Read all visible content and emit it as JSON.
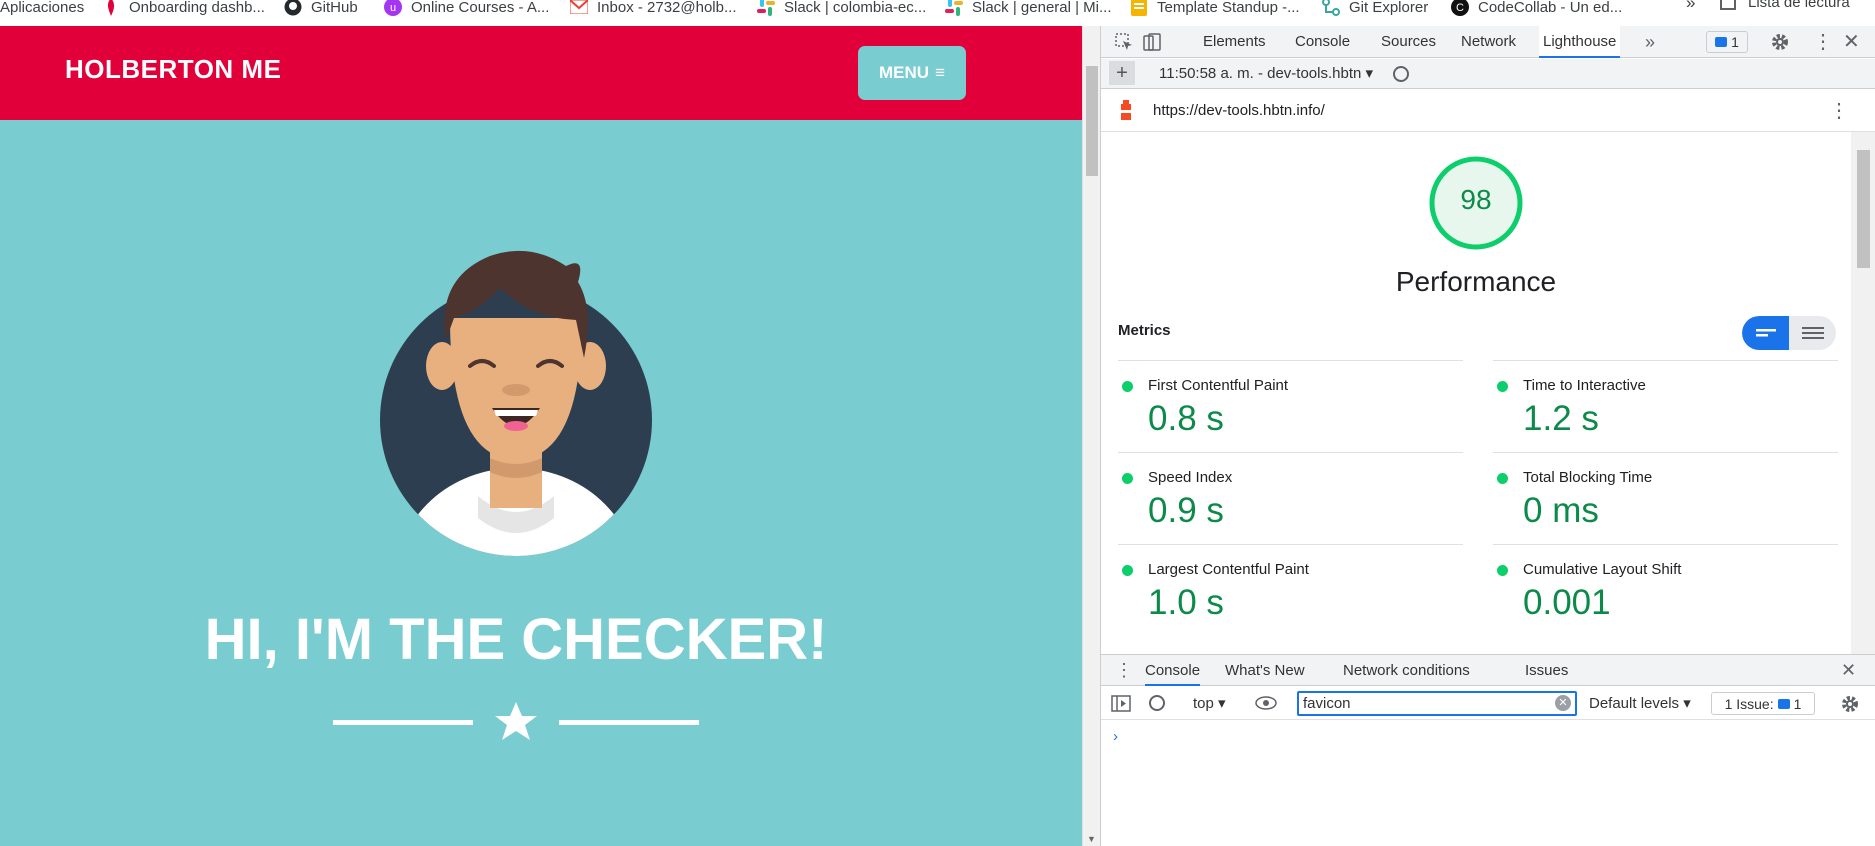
{
  "bookmarks": {
    "items": [
      {
        "label": "Aplicaciones",
        "icon": "apps-grid-icon"
      },
      {
        "label": "Onboarding dashb...",
        "icon": "holberton-icon"
      },
      {
        "label": "GitHub",
        "icon": "github-icon"
      },
      {
        "label": "Online Courses - A...",
        "icon": "udemy-icon"
      },
      {
        "label": "Inbox - 2732@holb...",
        "icon": "gmail-icon"
      },
      {
        "label": "Slack | colombia-ec...",
        "icon": "slack-icon"
      },
      {
        "label": "Slack | general | Mi...",
        "icon": "slack-icon"
      },
      {
        "label": "Template Standup -...",
        "icon": "docs-icon"
      },
      {
        "label": "Git Explorer",
        "icon": "git-explorer-icon"
      },
      {
        "label": "CodeCollab - Un ed...",
        "icon": "codecollab-icon"
      }
    ],
    "more": "»",
    "reading_list": "Lista de lectura"
  },
  "site": {
    "brand": "HOLBERTON ME",
    "menu_label": "MENU",
    "hero_title": "HI, I'M THE CHECKER!"
  },
  "devtools": {
    "tabs": [
      "Elements",
      "Console",
      "Sources",
      "Network",
      "Lighthouse"
    ],
    "active_tab": "Lighthouse",
    "issues_count": "1",
    "report_selector": "11:50:58 a. m. - dev-tools.hbtn",
    "url": "https://dev-tools.hbtn.info/",
    "score": "98",
    "category": "Performance",
    "metrics_heading": "Metrics",
    "metrics": [
      {
        "label": "First Contentful Paint",
        "value": "0.8 s"
      },
      {
        "label": "Time to Interactive",
        "value": "1.2 s"
      },
      {
        "label": "Speed Index",
        "value": "0.9 s"
      },
      {
        "label": "Total Blocking Time",
        "value": "0 ms"
      },
      {
        "label": "Largest Contentful Paint",
        "value": "1.0 s"
      },
      {
        "label": "Cumulative Layout Shift",
        "value": "0.001"
      }
    ],
    "drawer_tabs": [
      "Console",
      "What's New",
      "Network conditions",
      "Issues"
    ],
    "context": "top",
    "filter_value": "favicon",
    "levels": "Default levels",
    "issue_label": "1 Issue:",
    "issue_count": "1",
    "prompt": "›"
  },
  "colors": {
    "brand_red": "#e2003b",
    "teal": "#79ccd0",
    "pass_green": "#0cce6b",
    "accent_blue": "#1a73e8"
  }
}
